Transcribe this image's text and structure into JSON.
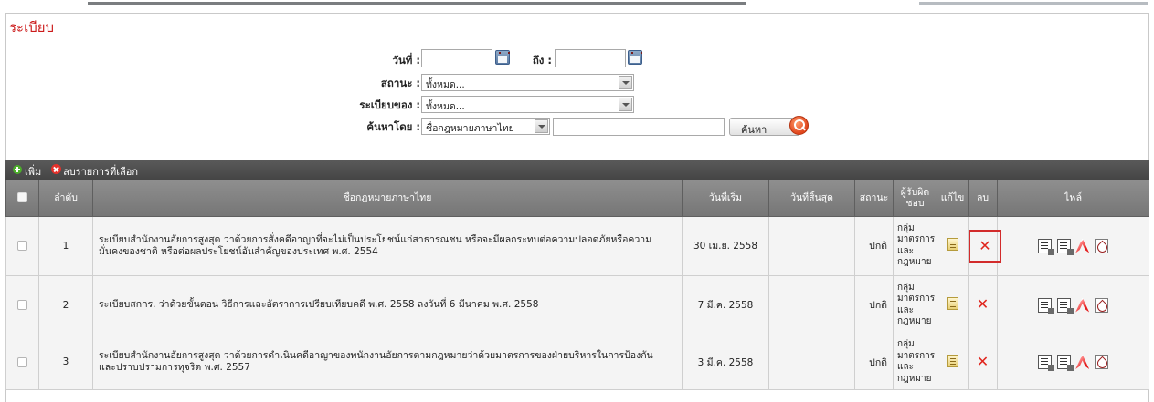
{
  "page": {
    "title": "ระเบียบ"
  },
  "filters": {
    "date_label": "วันที่ :",
    "to_label": "ถึง :",
    "date_from": "",
    "date_to": "",
    "status_label": "สถานะ :",
    "status_value": "ทั้งหมด...",
    "owner_label": "ระเบียบของ :",
    "owner_value": "ทั้งหมด...",
    "search_by_label": "ค้นหาโดย :",
    "search_by_value": "ชื่อกฎหมายภาษาไทย",
    "search_text": "",
    "search_button": "ค้นหา"
  },
  "toolbar": {
    "add_label": "เพิ่ม",
    "delete_selected_label": "ลบรายการที่เลือก"
  },
  "table": {
    "headers": {
      "seq": "ลำดับ",
      "name": "ชื่อกฎหมายภาษาไทย",
      "start": "วันที่เริ่ม",
      "end": "วันที่สิ้นสุด",
      "status": "สถานะ",
      "responsible": "ผู้รับผิดชอบ",
      "edit": "แก้ไข",
      "delete": "ลบ",
      "files": "ไฟล์"
    },
    "rows": [
      {
        "seq": "1",
        "name": "ระเบียบสำนักงานอัยการสูงสุด ว่าด้วยการสั่งคดีอาญาที่จะไม่เป็นประโยชน์แก่สาธารณชน หรือจะมีผลกระทบต่อความปลอดภัยหรือความมั่นคงของชาติ หรือต่อผลประโยชน์อันสำคัญของประเทศ พ.ศ. 2554",
        "start": "30 เม.ย. 2558",
        "end": "",
        "status": "ปกติ",
        "responsible": "กลุ่มมาตรการและกฎหมาย"
      },
      {
        "seq": "2",
        "name": "ระเบียบสกกร. ว่าด้วยขั้นตอน วิธีการและอัตราการเปรียบเทียบคดี พ.ศ. 2558 ลงวันที่ 6 มีนาคม พ.ศ. 2558",
        "start": "7 มี.ค. 2558",
        "end": "",
        "status": "ปกติ",
        "responsible": "กลุ่มมาตรการและกฎหมาย"
      },
      {
        "seq": "3",
        "name": "ระเบียบสำนักงานอัยการสูงสุด ว่าด้วยการดำเนินคดีอาญาของพนักงานอัยการตามกฎหมายว่าด้วยมาตรการของฝ่ายบริหารในการป้องกันและปราบปรามการทุจริต พ.ศ. 2557",
        "start": "3 มี.ค. 2558",
        "end": "",
        "status": "ปกติ",
        "responsible": "กลุ่มมาตรการและกฎหมาย"
      }
    ]
  },
  "colors": {
    "title_red": "#cc1b1b",
    "toolbar_bg": "#4f4f4f",
    "header_bg": "#828282",
    "delete_red": "#e0261e"
  }
}
